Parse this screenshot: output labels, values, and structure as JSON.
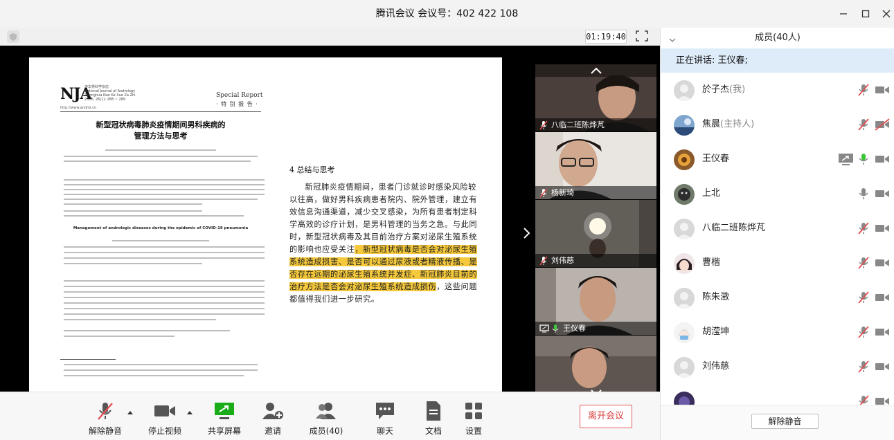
{
  "window": {
    "title": "腾讯会议 会议号：402 422 108"
  },
  "meeting": {
    "timer": "01:19:40"
  },
  "shared_doc": {
    "logo": "NJA",
    "journal_lines": [
      "中华男科学杂志",
      "National Journal of Andrology",
      "Zhonghua Nan Ke Xue Za Zhi",
      "2020, 26(1): 288 ~ 289"
    ],
    "url": "http://www.androl.cn",
    "special_report_en": "Special Report",
    "special_report_cn": "· 特 别 报 告 ·",
    "cn_title_line1": "新型冠状病毒肺炎疫情期间男科疾病的",
    "cn_title_line2": "管理方法与思考",
    "en_title": "Management of andrologic diseases during the epidemic of COVID-19 pneumonia",
    "section_heading": "4  总结与思考",
    "para_normal": "新冠肺炎疫情期间，患者门诊就诊时感染风险较以往高，做好男科疾病患者院内、院外管理，建立有效信息沟通渠道，减少交叉感染，为所有患者制定科学高效的诊疗计划，是男科管理的当务之急。与此同时，新型冠状病毒及其目前治疗方案对泌尿生殖系统的影响也应受关注",
    "para_highlight": "，新型冠状病毒是否会对泌尿生殖系统造成损害、是否可以通过尿液或者精液传播、是否存在远期的泌尿生殖系统并发症、新冠肺炎目前的治疗方法是否会对泌尿生殖系统造成损伤",
    "para_end": "，这些问题都值得我们进一步研究。"
  },
  "videos": [
    {
      "name": "八临二班陈烨芃",
      "mic": "muted",
      "screen": false
    },
    {
      "name": "杨新琦",
      "mic": "muted",
      "screen": false
    },
    {
      "name": "刘伟慈",
      "mic": "muted",
      "screen": false
    },
    {
      "name": "王仪春",
      "mic": "active",
      "screen": true
    },
    {
      "name": "上北",
      "mic": "on",
      "screen": false
    }
  ],
  "toolbar": {
    "unmute": "解除静音",
    "stop_video": "停止视频",
    "share_screen": "共享屏幕",
    "invite": "邀请",
    "members": "成员(40)",
    "chat": "聊天",
    "docs": "文档",
    "settings": "设置",
    "leave": "离开会议"
  },
  "panel": {
    "header": "成员(40人)",
    "speaking": "正在讲话: 王仪春;",
    "unmute_all": "解除静音",
    "members": [
      {
        "name": "於子杰",
        "role": "(我)",
        "mic": "muted",
        "cam": "on",
        "screen": false,
        "avatar": "default"
      },
      {
        "name": "焦晨",
        "role": "(主持人)",
        "mic": "muted",
        "cam": "off",
        "screen": false,
        "avatar": "sky"
      },
      {
        "name": "王仪春",
        "role": "",
        "mic": "active",
        "cam": "on",
        "screen": true,
        "avatar": "flower"
      },
      {
        "name": "上北",
        "role": "",
        "mic": "on",
        "cam": "on",
        "screen": false,
        "avatar": "cat"
      },
      {
        "name": "八临二班陈烨芃",
        "role": "",
        "mic": "muted",
        "cam": "on",
        "screen": false,
        "avatar": "default"
      },
      {
        "name": "曹楷",
        "role": "",
        "mic": "muted",
        "cam": "on",
        "screen": false,
        "avatar": "anime"
      },
      {
        "name": "陈朱澂",
        "role": "",
        "mic": "muted",
        "cam": "on",
        "screen": false,
        "avatar": "default"
      },
      {
        "name": "胡滢坤",
        "role": "",
        "mic": "muted",
        "cam": "on",
        "screen": false,
        "avatar": "mask"
      },
      {
        "name": "刘伟慈",
        "role": "",
        "mic": "muted",
        "cam": "on",
        "screen": false,
        "avatar": "default"
      },
      {
        "name": "",
        "role": "",
        "mic": "muted",
        "cam": "on",
        "screen": false,
        "avatar": "partial"
      }
    ]
  },
  "colors": {
    "accent": "#1aad19",
    "speaking_bg": "#deebf9",
    "highlight": "#f5c93b",
    "leave": "#e35a5a",
    "muted_red": "#e05252"
  }
}
